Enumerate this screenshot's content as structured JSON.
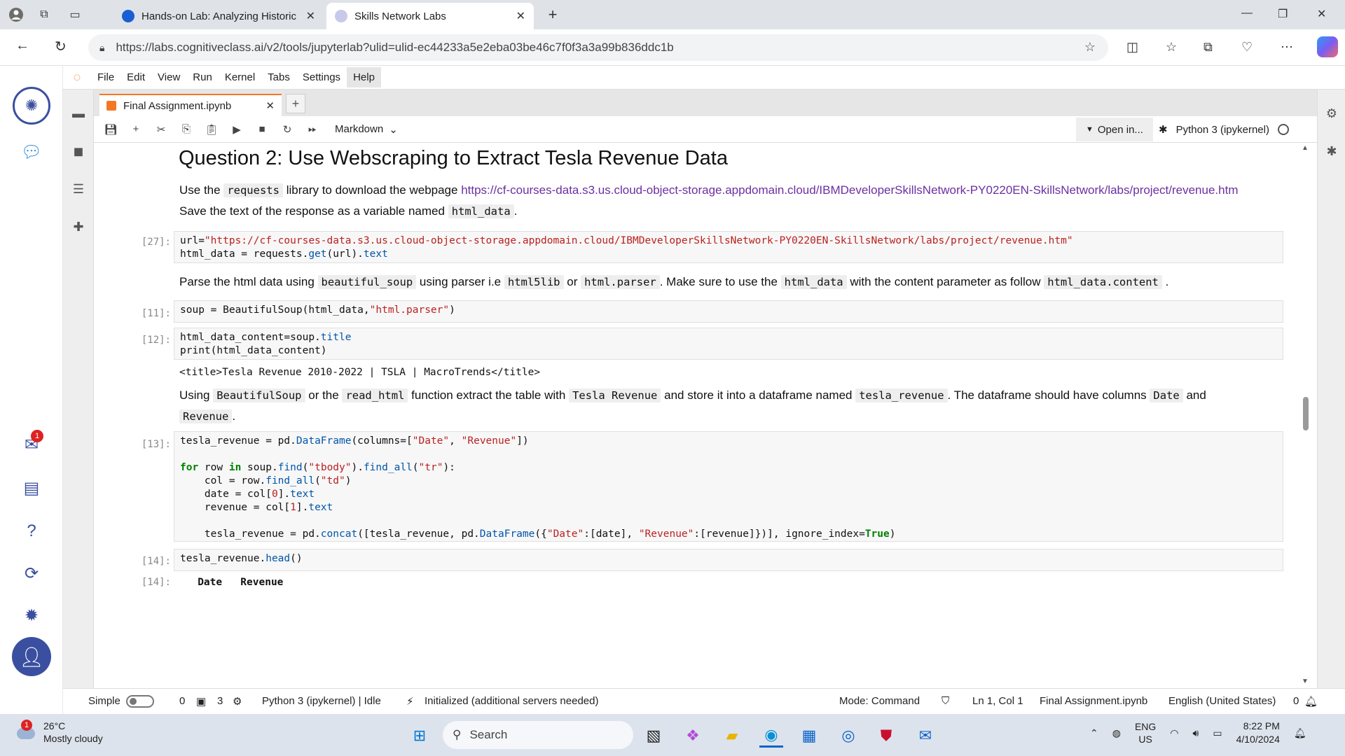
{
  "browser": {
    "tabs": [
      {
        "title": "Hands-on Lab: Analyzing Historic",
        "active": false
      },
      {
        "title": "Skills Network Labs",
        "active": true
      }
    ],
    "url": "https://labs.cognitiveclass.ai/v2/tools/jupyterlab?ulid=ulid-ec44233a5e2eba03be46c7f0f3a3a99b836ddc1b"
  },
  "jupyter": {
    "menu": [
      "File",
      "Edit",
      "View",
      "Run",
      "Kernel",
      "Tabs",
      "Settings",
      "Help"
    ],
    "doc_tab": "Final Assignment.ipynb",
    "cell_type": "Markdown",
    "open_in": "Open in...",
    "kernel": "Python 3 (ipykernel)"
  },
  "notebook": {
    "heading": "Question 2: Use Webscraping to Extract Tesla Revenue Data",
    "md1": {
      "p1": "Use the ",
      "c1": "requests",
      "p2": " library to download the webpage ",
      "link": "https://cf-courses-data.s3.us.cloud-object-storage.appdomain.cloud/IBMDeveloperSkillsNetwork-PY0220EN-SkillsNetwork/labs/project/revenue.htm",
      "p3": " Save the text of the response as a variable named ",
      "c2": "html_data",
      "p4": "."
    },
    "cell27": {
      "prompt": "[27]:",
      "line1_a": "url=",
      "line1_str": "\"https://cf-courses-data.s3.us.cloud-object-storage.appdomain.cloud/IBMDeveloperSkillsNetwork-PY0220EN-SkillsNetwork/labs/project/revenue.htm\"",
      "line2_a": "html_data = requests.",
      "line2_fn": "get",
      "line2_b": "(url).",
      "line2_attr": "text"
    },
    "md2": {
      "p1": "Parse the html data using ",
      "c1": "beautiful_soup",
      "p2": " using parser i.e ",
      "c2": "html5lib",
      "p3": " or ",
      "c3": "html.parser",
      "p4": ". Make sure to use the ",
      "c4": "html_data",
      "p5": " with the content parameter as follow ",
      "c5": "html_data.content",
      "p6": " ."
    },
    "cell11": {
      "prompt": "[11]:",
      "a": "soup = BeautifulSoup(html_data,",
      "str": "\"html.parser\"",
      "b": ")"
    },
    "cell12": {
      "prompt": "[12]:",
      "l1_a": "html_data_content=soup.",
      "l1_attr": "title",
      "l2": "print(html_data_content)",
      "output": "<title>Tesla Revenue 2010-2022 | TSLA | MacroTrends</title>"
    },
    "md3": {
      "p1": "Using ",
      "c1": "BeautifulSoup",
      "p2": " or the ",
      "c2": "read_html",
      "p3": " function extract the table with ",
      "c3": "Tesla Revenue",
      "p4": " and store it into a dataframe named ",
      "c4": "tesla_revenue",
      "p5": ". The dataframe should have columns ",
      "c5": "Date",
      "p6": " and",
      "c6": "Revenue",
      "p7": "."
    },
    "cell13": {
      "prompt": "[13]:",
      "l1_a": "tesla_revenue = pd.",
      "l1_fn": "DataFrame",
      "l1_b": "(columns=[",
      "l1_s1": "\"Date\"",
      "l1_c": ", ",
      "l1_s2": "\"Revenue\"",
      "l1_d": "])",
      "l3_kw1": "for",
      "l3_a": " row ",
      "l3_kw2": "in",
      "l3_b": " soup.",
      "l3_fn1": "find",
      "l3_c": "(",
      "l3_s1": "\"tbody\"",
      "l3_d": ").",
      "l3_fn2": "find_all",
      "l3_e": "(",
      "l3_s2": "\"tr\"",
      "l3_f": "):",
      "l4_a": "    col = row.",
      "l4_fn": "find_all",
      "l4_b": "(",
      "l4_s": "\"td\"",
      "l4_c": ")",
      "l5_a": "    date = col[",
      "l5_n": "0",
      "l5_b": "].",
      "l5_attr": "text",
      "l6_a": "    revenue = col[",
      "l6_n": "1",
      "l6_b": "].",
      "l6_attr": "text",
      "l8_a": "    tesla_revenue = pd.",
      "l8_fn1": "concat",
      "l8_b": "([tesla_revenue, pd.",
      "l8_fn2": "DataFrame",
      "l8_c": "({",
      "l8_s1": "\"Date\"",
      "l8_d": ":[date], ",
      "l8_s2": "\"Revenue\"",
      "l8_e": ":[revenue]})], ignore_index=",
      "l8_kw": "True",
      "l8_f": ")"
    },
    "cell14": {
      "prompt": "[14]:",
      "a": "tesla_revenue.",
      "fn": "head",
      "b": "()"
    },
    "cell14_out": {
      "prompt": "[14]:",
      "header": "   Date   Revenue"
    }
  },
  "statusbar": {
    "mode_label": "Simple",
    "count0": "0",
    "terminals": "3",
    "kernel_status": "Python 3 (ipykernel) | Idle",
    "init": "Initialized (additional servers needed)",
    "mode": "Mode: Command",
    "cursor": "Ln 1, Col 1",
    "file": "Final Assignment.ipynb",
    "lang": "English (United States)",
    "notif_count": "0"
  },
  "taskbar": {
    "temp": "26°C",
    "weather": "Mostly cloudy",
    "weather_badge": "1",
    "search": "Search",
    "lang1": "ENG",
    "lang2": "US",
    "time": "8:22 PM",
    "date": "4/10/2024"
  },
  "rail": {
    "mail_badge": "1"
  }
}
